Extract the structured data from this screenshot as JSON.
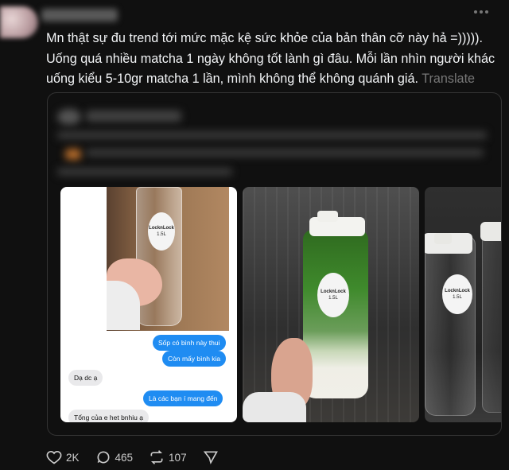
{
  "post": {
    "text": "Mn thật sự đu trend tới mức mặc kệ sức khỏe của bản thân cỡ này hả =))))). Uống quá nhiều matcha 1 ngày không tốt lành gì đâu. Mỗi lần nhìn người khác uống kiểu 5-10gr matcha 1 lần, mình không thể không quánh giá.",
    "translate_label": "Translate"
  },
  "images": {
    "label_brand": "LocknLock",
    "label_volume": "1.5L",
    "chat": [
      {
        "from": "me",
        "text": "Sốp có bình này thui"
      },
      {
        "from": "me",
        "text": "Còn mấy bình kia"
      },
      {
        "from": "them",
        "text": "Dạ dc ạ"
      },
      {
        "from": "me",
        "text": "Là các bạn í mang đến"
      },
      {
        "from": "them",
        "text": "Tổng của e het bnhiu ạ"
      }
    ]
  },
  "actions": {
    "likes": "2K",
    "comments": "465",
    "reposts": "107"
  },
  "colors": {
    "background": "#101010",
    "text": "#f3f5f7",
    "muted": "#777777",
    "imessage_blue": "#1f8cf2"
  }
}
